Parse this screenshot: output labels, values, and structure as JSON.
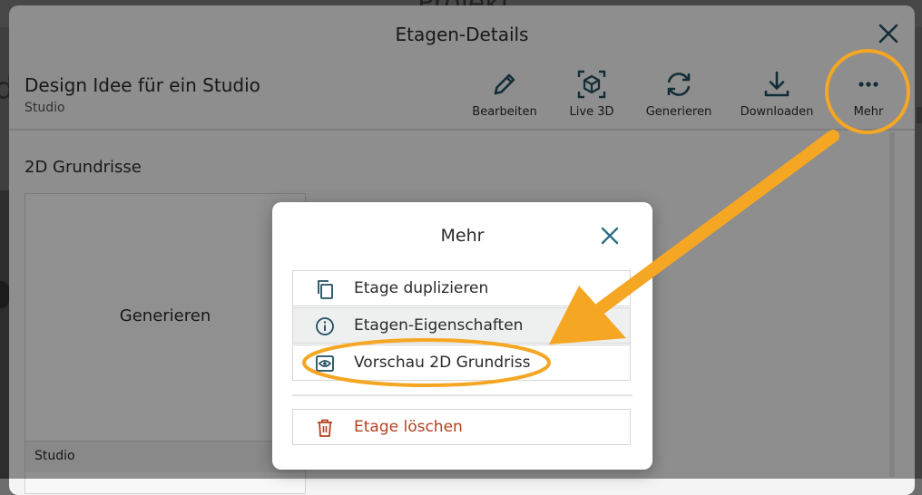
{
  "background": {
    "partial_title": "Projekt"
  },
  "dialog": {
    "title": "Etagen-Details",
    "floor_name": "Design Idee für ein Studio",
    "floor_sub": "Studio",
    "toolbar": [
      {
        "label": "Bearbeiten",
        "icon": "pencil-icon"
      },
      {
        "label": "Live 3D",
        "icon": "cube-3d-icon"
      },
      {
        "label": "Generieren",
        "icon": "refresh-icon"
      },
      {
        "label": "Downloaden",
        "icon": "download-icon"
      },
      {
        "label": "Mehr",
        "icon": "more-dots-icon"
      }
    ],
    "section_title": "2D Grundrisse",
    "card": {
      "action": "Generieren",
      "footer": "Studio"
    }
  },
  "popup": {
    "title": "Mehr",
    "items": [
      {
        "label": "Etage duplizieren",
        "icon": "copy-icon"
      },
      {
        "label": "Etagen-Eigenschaften",
        "icon": "info-icon"
      },
      {
        "label": "Vorschau 2D Grundriss",
        "icon": "eye-icon"
      }
    ],
    "danger_item": {
      "label": "Etage löschen",
      "icon": "trash-icon"
    }
  },
  "colors": {
    "icon_teal": "#1f4e5f",
    "close_blue": "#2b6f86",
    "danger": "#b5411f",
    "annotation_orange": "#f5a623"
  }
}
